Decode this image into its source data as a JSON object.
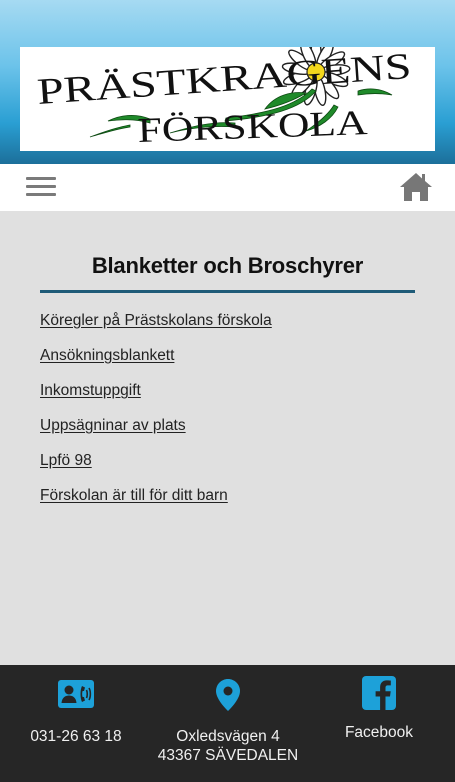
{
  "logo": {
    "line1": "PRÄSTKRAGENS",
    "line2": "FÖRSKOLA"
  },
  "nav": {
    "menu_icon": "hamburger-menu-icon",
    "home_icon": "home-icon"
  },
  "main": {
    "title": "Blanketter och Broschyrer",
    "links": [
      "Köregler på Prästskolans förskola",
      "Ansökningsblankett",
      "Inkomstuppgift",
      "Uppsägninar av plats",
      "Lpfö 98",
      "Förskolan är till för ditt barn"
    ]
  },
  "footer": {
    "phone_icon": "contact-card-icon",
    "phone": "031-26 63 18",
    "address_icon": "map-pin-icon",
    "address_line1": "Oxledsvägen 4",
    "address_line2": "43367 SÄVEDALEN",
    "facebook_icon": "facebook-icon",
    "facebook_label": "Facebook"
  },
  "colors": {
    "accent_blue": "#1da1d9",
    "title_rule": "#1f5b78",
    "footer_bg": "#262626",
    "content_bg": "#e0e0e0"
  }
}
